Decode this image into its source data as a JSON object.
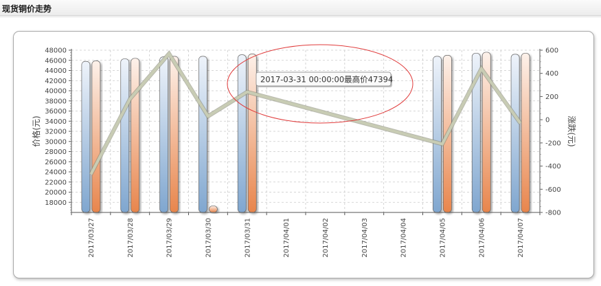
{
  "header": {
    "title": "现货铜价走势"
  },
  "chart_data": {
    "type": "bar",
    "categories": [
      "2017/03/27",
      "2017/03/28",
      "2017/03/29",
      "2017/03/30",
      "2017/03/31",
      "2017/04/01",
      "2017/04/02",
      "2017/04/03",
      "2017/04/04",
      "2017/04/05",
      "2017/04/06",
      "2017/04/07"
    ],
    "series": [
      {
        "axis": "left",
        "kind": "bar",
        "color_top": "#eef3fa",
        "color_bottom": "#7fa6cf",
        "values": [
          45800,
          46300,
          46700,
          46800,
          47100,
          null,
          null,
          null,
          null,
          46800,
          47400,
          47200
        ]
      },
      {
        "axis": "left",
        "kind": "bar",
        "color_top": "#fdf1ea",
        "color_bottom": "#e8854c",
        "values": [
          45900,
          46400,
          46800,
          17300,
          47250,
          null,
          null,
          null,
          null,
          47000,
          47600,
          47400
        ]
      },
      {
        "axis": "right",
        "kind": "line",
        "color": "#c8ccb4",
        "values": [
          -470,
          180,
          570,
          30,
          240,
          null,
          null,
          null,
          null,
          -210,
          440,
          -30
        ]
      }
    ],
    "ylabel": "价格(元)",
    "ylabel_right": "涨跌(元)",
    "ylim": [
      16000,
      48000
    ],
    "yticks": [
      18000,
      20000,
      22000,
      24000,
      26000,
      28000,
      30000,
      32000,
      34000,
      36000,
      38000,
      40000,
      42000,
      44000,
      46000,
      48000
    ],
    "ylim_right": [
      -800,
      600
    ],
    "yticks_right": [
      -800,
      -600,
      -400,
      -200,
      0,
      200,
      400,
      600
    ],
    "grid": true,
    "tooltip": {
      "text": "2017-03-31 00:00:00最高价47394",
      "category_index": 4
    },
    "annotation": {
      "shape": "ellipse",
      "color": "#e03a3a",
      "around": "tooltip"
    }
  }
}
